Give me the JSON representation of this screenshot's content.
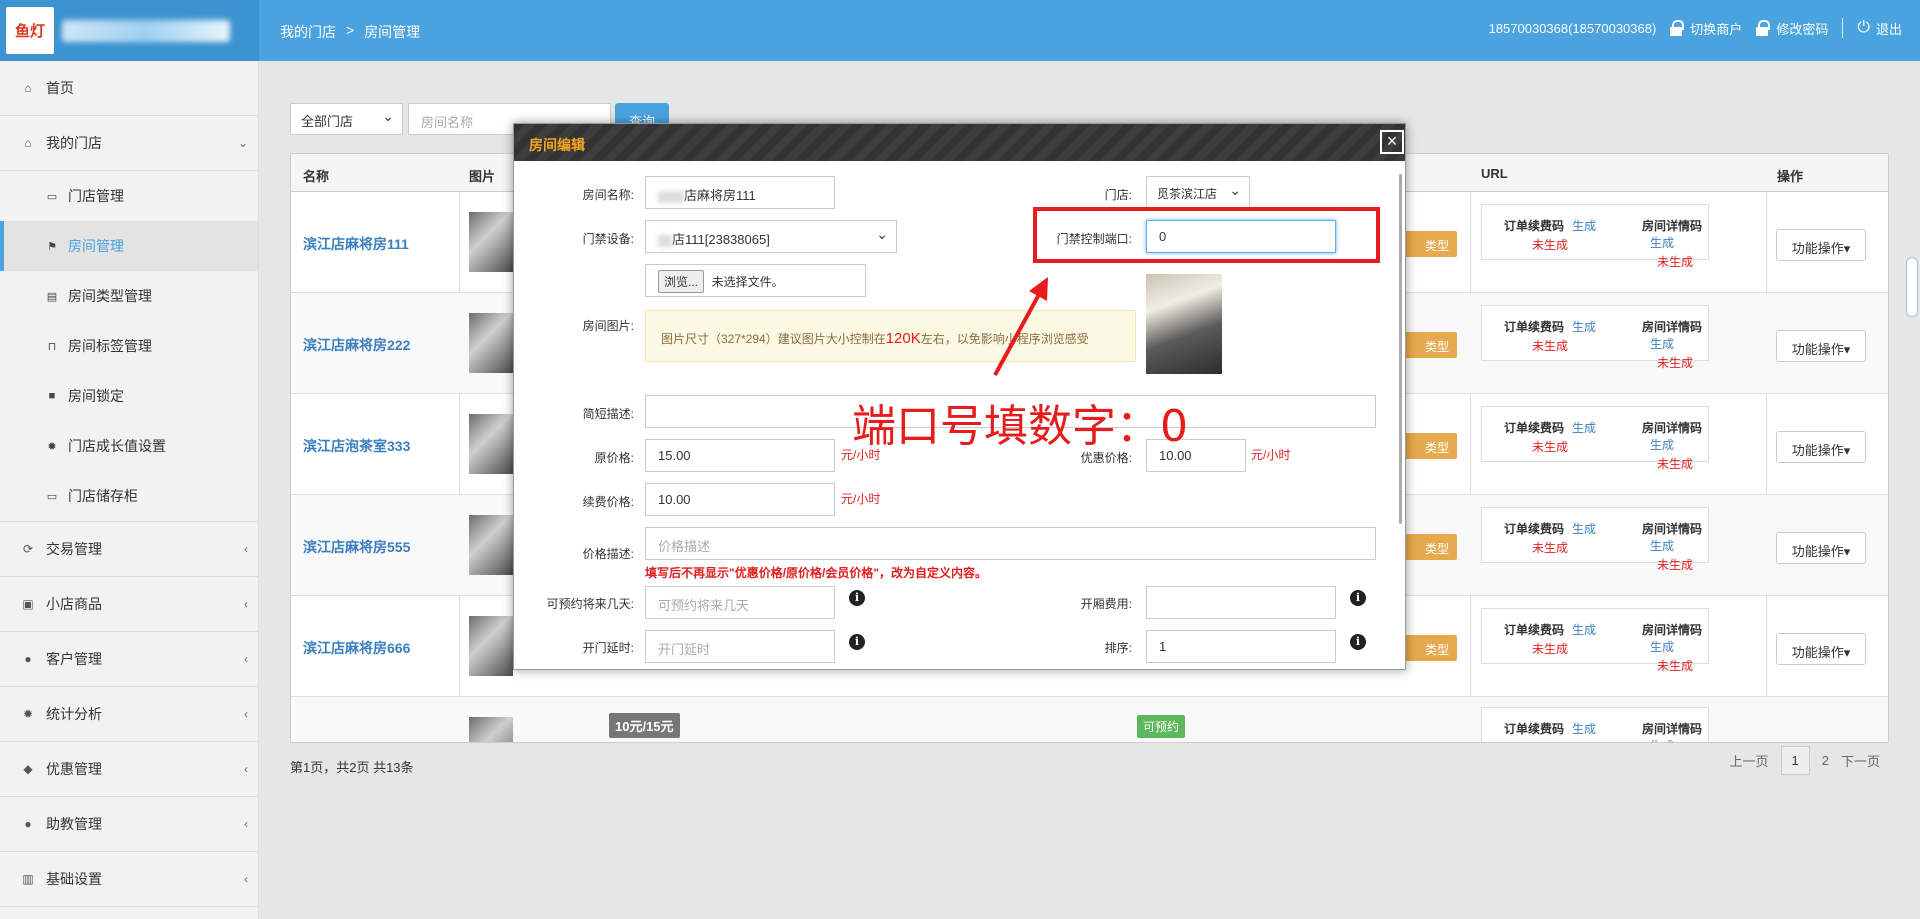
{
  "header": {
    "logo_text": "鱼灯",
    "breadcrumb": [
      "我的门店",
      ">",
      "房间管理"
    ],
    "account": "18570030368(18570030368)",
    "switch_merchant": "切换商户",
    "change_password": "修改密码",
    "logout": "退出"
  },
  "sidebar": {
    "items": [
      {
        "label": "首页",
        "icon": "home-icon"
      },
      {
        "label": "我的门店",
        "icon": "store-icon"
      },
      {
        "label": "交易管理",
        "icon": "refresh-icon"
      },
      {
        "label": "小店商品",
        "icon": "gift-icon"
      },
      {
        "label": "客户管理",
        "icon": "user-icon"
      },
      {
        "label": "统计分析",
        "icon": "gear-icon"
      },
      {
        "label": "优惠管理",
        "icon": "tags-icon"
      },
      {
        "label": "助教管理",
        "icon": "user-icon"
      },
      {
        "label": "基础设置",
        "icon": "barcode-icon"
      }
    ],
    "store_sub": [
      {
        "label": "门店管理"
      },
      {
        "label": "房间管理"
      },
      {
        "label": "房间类型管理"
      },
      {
        "label": "房间标签管理"
      },
      {
        "label": "房间锁定"
      },
      {
        "label": "门店成长值设置"
      },
      {
        "label": "门店储存柜"
      }
    ]
  },
  "filter": {
    "store_select": "全部门店",
    "room_name_placeholder": "房间名称",
    "query_button": "查询"
  },
  "table": {
    "headers": {
      "name": "名称",
      "image": "图片",
      "url": "URL",
      "action": "操作"
    },
    "rows": [
      {
        "name": "滨江店麻将房111"
      },
      {
        "name": "滨江店麻将房222"
      },
      {
        "name": "滨江店泡茶室333"
      },
      {
        "name": "滨江店麻将房555"
      },
      {
        "name": "滨江店麻将房666"
      },
      {
        "name": ""
      }
    ],
    "type_tag": "类型",
    "order_code": "订单续费码",
    "detail_code": "房间详情码",
    "generate": "生成",
    "not_generated": "未生成",
    "func_button": "功能操作▾",
    "partial_price": "10元/15元",
    "partial_status": "可预约"
  },
  "pagination": {
    "summary": "第1页，共2页 共13条",
    "prev": "上一页",
    "current": "1",
    "page2": "2",
    "next": "下一页"
  },
  "modal": {
    "title": "房间编辑",
    "room_name_label": "房间名称:",
    "room_name_value": "店麻将房111",
    "store_label": "门店:",
    "store_value": "觅茶滨江店",
    "door_device_label": "门禁设备:",
    "door_device_value": "店111[23838065]",
    "door_port_label": "门禁控制端口:",
    "door_port_value": "0",
    "browse_button": "浏览...",
    "no_file": "未选择文件。",
    "room_image_label": "房间图片:",
    "image_tip_prefix": "图片尺寸（327*294）建议图片大小控制在",
    "image_tip_size": "120K",
    "image_tip_suffix": "左右，以免影响小程序浏览感受",
    "short_desc_label": "简短描述:",
    "original_price_label": "原价格:",
    "original_price_value": "15.00",
    "discount_price_label": "优惠价格:",
    "discount_price_value": "10.00",
    "renew_price_label": "续费价格:",
    "renew_price_value": "10.00",
    "unit": "元/小时",
    "price_desc_label": "价格描述:",
    "price_desc_placeholder": "价格描述",
    "price_desc_warning": "填写后不再显示\"优惠价格/原价格/会员价格\"，改为自定义内容。",
    "future_days_label": "可预约将来几天:",
    "future_days_placeholder": "可预约将来几天",
    "room_fee_label": "开厢费用:",
    "door_delay_label": "开门延时:",
    "door_delay_placeholder": "开门延时",
    "sort_label": "排序:",
    "sort_value": "1"
  },
  "annotation": {
    "text": "端口号填数字：0"
  }
}
